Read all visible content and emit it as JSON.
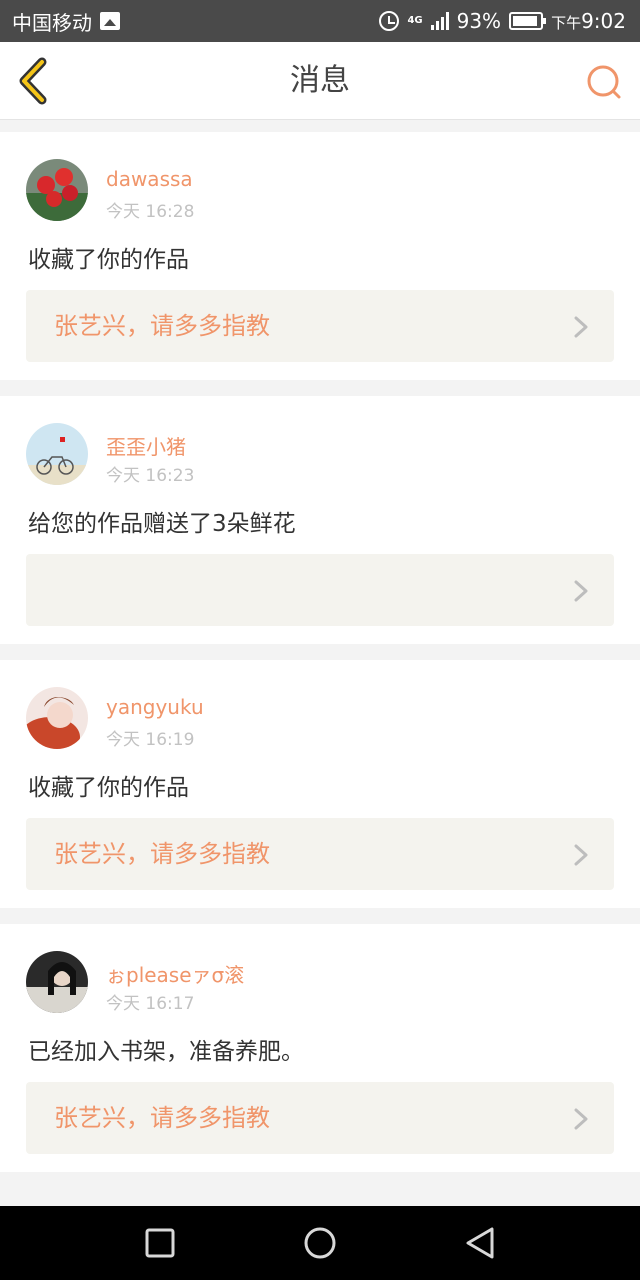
{
  "status_bar": {
    "carrier": "中国移动",
    "network": "4G",
    "battery": "93%",
    "battery_level": 0.93,
    "time_prefix": "下午",
    "time": "9:02"
  },
  "header": {
    "title": "消息",
    "accent_color": "#f0956a"
  },
  "messages": [
    {
      "username": "dawassa",
      "time": "今天 16:28",
      "action": "收藏了你的作品",
      "work_title": "张艺兴，请多多指教",
      "avatar": "roses-avatar"
    },
    {
      "username": "歪歪小猪",
      "time": "今天 16:23",
      "action": "给您的作品赠送了3朵鲜花",
      "work_title": "",
      "avatar": "bicycle-avatar"
    },
    {
      "username": "yangyuku",
      "time": "今天 16:19",
      "action": "收藏了你的作品",
      "work_title": "张艺兴，请多多指教",
      "avatar": "portrait-avatar"
    },
    {
      "username": "ぉpleaseァσ滚",
      "time": "今天 16:17",
      "action": "已经加入书架，准备养肥。",
      "work_title": "张艺兴，请多多指教",
      "avatar": "dark-portrait-avatar"
    }
  ],
  "nav_bar": {
    "icons": [
      "recent-apps-icon",
      "home-icon",
      "back-triangle-icon"
    ]
  }
}
